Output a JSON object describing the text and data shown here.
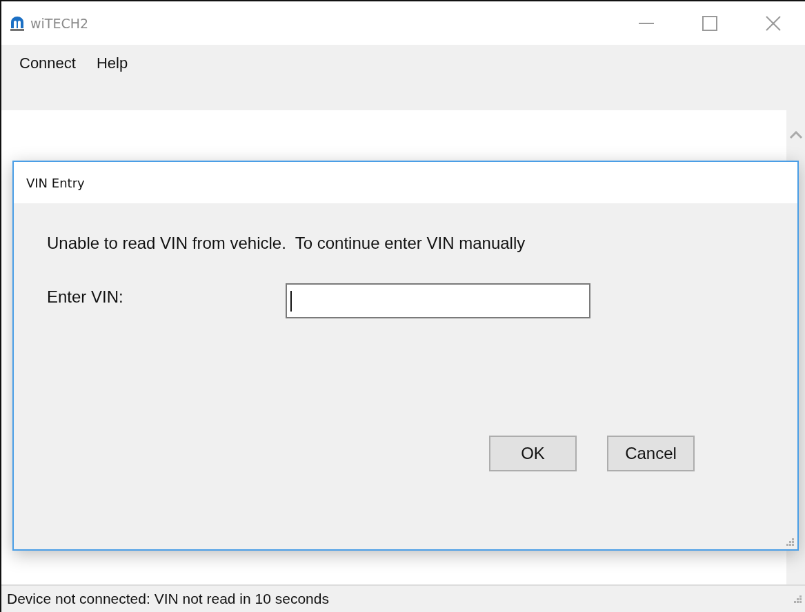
{
  "window": {
    "title": "wiTECH2"
  },
  "menu": [
    "Connect",
    "Help"
  ],
  "dialog": {
    "title": "VIN Entry",
    "message": "Unable to read VIN from vehicle.  To continue enter VIN manually",
    "field_label": "Enter VIN:",
    "vin": {
      "focused": true
    },
    "buttons": [
      "OK",
      "Cancel"
    ]
  },
  "status_bar": "Device not connected: VIN not read in 10 seconds"
}
